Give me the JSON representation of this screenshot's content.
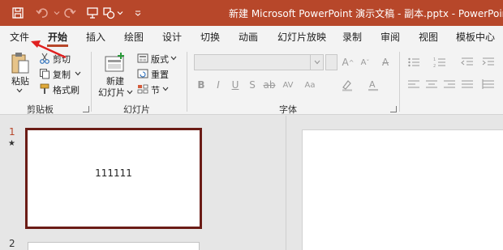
{
  "window": {
    "title": "新建 Microsoft PowerPoint 演示文稿 - 副本.pptx  -  PowerPoint"
  },
  "quick_access": [
    {
      "name": "save",
      "icon": "save-icon"
    },
    {
      "name": "undo",
      "icon": "undo-icon"
    },
    {
      "name": "redo",
      "icon": "redo-icon"
    },
    {
      "name": "present",
      "icon": "present-from-beginning-icon"
    },
    {
      "name": "shapes",
      "icon": "shapes-icon"
    },
    {
      "name": "customize",
      "icon": "chevron-down-icon"
    }
  ],
  "tabs": [
    {
      "label": "文件"
    },
    {
      "label": "开始",
      "active": true
    },
    {
      "label": "插入"
    },
    {
      "label": "绘图"
    },
    {
      "label": "设计"
    },
    {
      "label": "切换"
    },
    {
      "label": "动画"
    },
    {
      "label": "幻灯片放映"
    },
    {
      "label": "录制"
    },
    {
      "label": "审阅"
    },
    {
      "label": "视图"
    },
    {
      "label": "模板中心"
    }
  ],
  "ribbon": {
    "clipboard": {
      "label": "剪贴板",
      "paste": "粘贴",
      "cut": "剪切",
      "copy": "复制",
      "format_painter": "格式刷"
    },
    "slides": {
      "label": "幻灯片",
      "new_slide_line1": "新建",
      "new_slide_line2": "幻灯片",
      "layout": "版式",
      "reset": "重置",
      "section": "节"
    },
    "font": {
      "label": "字体"
    }
  },
  "thumbnails": [
    {
      "number": "1",
      "marker": "★",
      "text": "111111",
      "selected": true
    },
    {
      "number": "2"
    }
  ],
  "colors": {
    "accent": "#b7472a",
    "selected_border": "#6b1c16",
    "annotation": "#e02020"
  }
}
